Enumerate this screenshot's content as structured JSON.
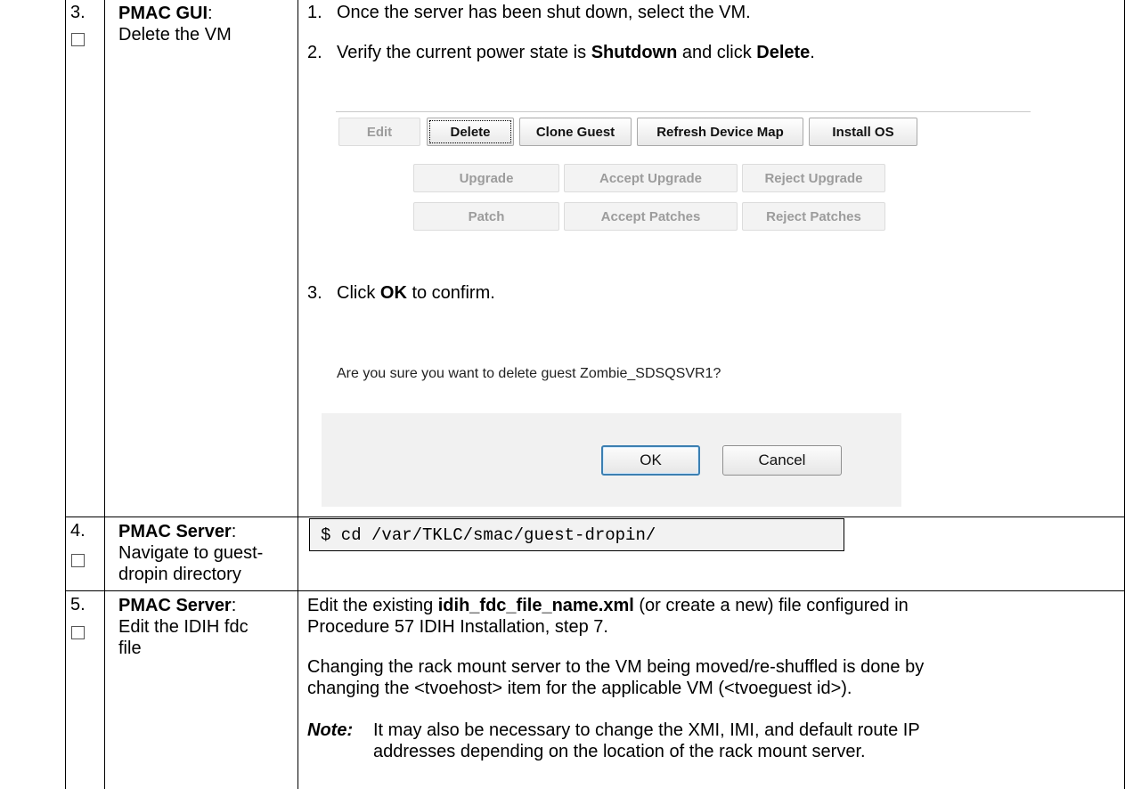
{
  "rows": [
    {
      "number": "3.",
      "title_bold": "PMAC GUI",
      "title_rest": "Delete the VM",
      "steps": [
        {
          "n": "1.",
          "text": "Once the server has been shut down, select the VM."
        },
        {
          "n": "2.",
          "pre": "Verify the current power state is ",
          "b1": "Shutdown",
          "mid": " and click ",
          "b2": "Delete",
          "post": "."
        },
        {
          "n": "3.",
          "pre": "Click ",
          "b1": "OK",
          "post": " to confirm."
        }
      ],
      "buttons": {
        "edit": "Edit",
        "delete": "Delete",
        "clone_guest": "Clone Guest",
        "refresh_device_map": "Refresh Device Map",
        "install_os": "Install OS",
        "upgrade": "Upgrade",
        "accept_upgrade": "Accept Upgrade",
        "reject_upgrade": "Reject Upgrade",
        "patch": "Patch",
        "accept_patches": "Accept Patches",
        "reject_patches": "Reject Patches"
      },
      "dialog": {
        "message": "Are you sure you want to delete guest Zombie_SDSQSVR1?",
        "ok": "OK",
        "cancel": "Cancel"
      }
    },
    {
      "number": "4.",
      "title_bold": "PMAC Server",
      "title_rest_1": "Navigate to guest-",
      "title_rest_2": "dropin directory",
      "command": "$ cd /var/TKLC/smac/guest-dropin/"
    },
    {
      "number": "5.",
      "title_bold": "PMAC Server",
      "title_rest_1": "Edit the IDIH fdc",
      "title_rest_2": "file",
      "p1_pre": "Edit the existing ",
      "p1_bold": "idih_fdc_file_name.xml",
      "p1_post": " (or create a new) file configured in",
      "p1_line2": "Procedure 57 IDIH Installation, step 7.",
      "p2_line1": "Changing the rack mount server to the VM being moved/re-shuffled is done by",
      "p2_line2": "changing the <tvoehost> item for the applicable VM (<tvoeguest id>).",
      "note_label": "Note:",
      "note_line1": "It may also be necessary to change the XMI, IMI, and default route IP",
      "note_line2": "addresses depending on the location of the rack mount server."
    }
  ]
}
